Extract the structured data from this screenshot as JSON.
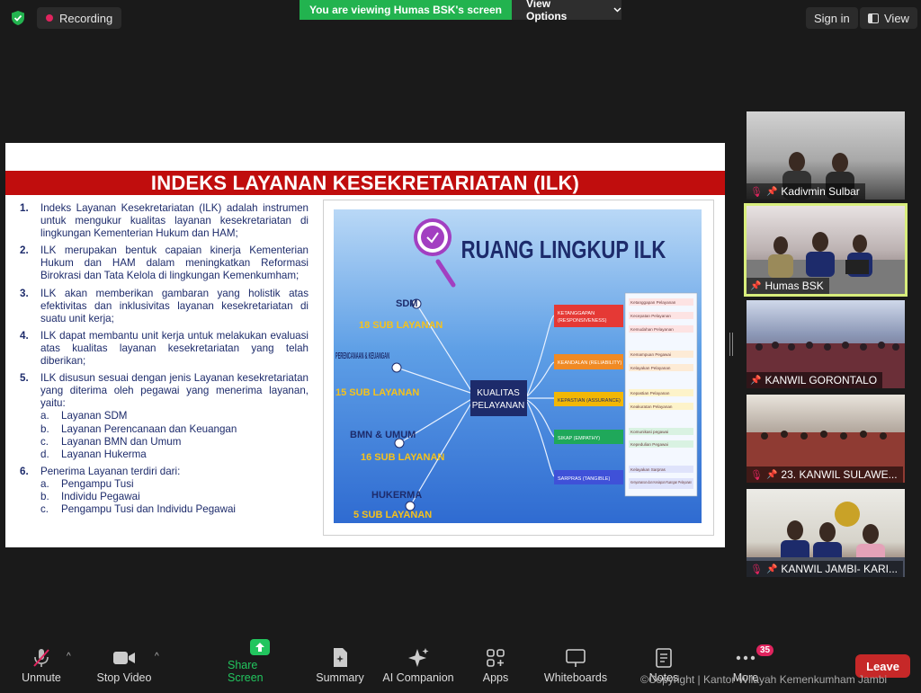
{
  "topbar": {
    "recording_label": "Recording",
    "share_banner": "You are viewing Humas BSK's screen",
    "view_options": "View Options",
    "signin": "Sign in",
    "view": "View"
  },
  "slide": {
    "title": "INDEKS LAYANAN KESEKRETARIATAN (ILK)",
    "points": [
      {
        "num": "1.",
        "text": "Indeks Layanan Kesekretariatan (ILK) adalah instrumen untuk mengukur kualitas layanan kesekretariatan di lingkungan Kementerian Hukum dan HAM;"
      },
      {
        "num": "2.",
        "text": "ILK merupakan bentuk capaian kinerja Kementerian Hukum dan HAM dalam meningkatkan Reformasi Birokrasi dan Tata Kelola di lingkungan Kemenkumham;"
      },
      {
        "num": "3.",
        "text": "ILK akan memberikan gambaran yang holistik atas efektivitas dan inklusivitas layanan kesekretariatan di suatu unit kerja;"
      },
      {
        "num": "4.",
        "text": "ILK dapat membantu unit kerja untuk melakukan evaluasi atas kualitas layanan kesekretariatan yang telah diberikan;"
      },
      {
        "num": "5.",
        "text": "ILK disusun sesuai dengan jenis Layanan kesekretariatan yang diterima oleh pegawai yang menerima layanan, yaitu:"
      },
      {
        "num": "6.",
        "text": "Penerima Layanan terdiri dari:"
      }
    ],
    "sub5": [
      {
        "l": "a.",
        "t": "Layanan SDM"
      },
      {
        "l": "b.",
        "t": "Layanan Perencanaan dan Keuangan"
      },
      {
        "l": "c.",
        "t": "Layanan BMN dan Umum"
      },
      {
        "l": "d.",
        "t": "Layanan Hukerma"
      }
    ],
    "sub6": [
      {
        "l": "a.",
        "t": "Pengampu Tusi"
      },
      {
        "l": "b.",
        "t": "Individu Pegawai"
      },
      {
        "l": "c.",
        "t": "Pengampu Tusi dan Individu Pegawai"
      }
    ]
  },
  "diagram": {
    "title": "RUANG LINGKUP ILK",
    "center": [
      "KUALITAS",
      "PELAYANAN"
    ],
    "sources": [
      {
        "name": "SDM",
        "count": "18 SUB LAYANAN"
      },
      {
        "name": "PERENCANAAN & KEUANGAN",
        "count": "15 SUB LAYANAN"
      },
      {
        "name": "BMN & UMUM",
        "count": "16 SUB LAYANAN"
      },
      {
        "name": "HUKERMA",
        "count": "5 SUB LAYANAN"
      }
    ],
    "dimensions": [
      {
        "label": "KETANGGAPAN (RESPONSIVENESS)",
        "color": "#e53935",
        "items": [
          "Ketanggapan Pelayanan",
          "Kecepatan Pelayanan",
          "Kemudahan Pelayanan"
        ]
      },
      {
        "label": "KEANDALAN (RELIABILITY)",
        "color": "#f08a24",
        "items": [
          "Kemampuan Pegawai",
          "Kelayakan Pelayanan"
        ]
      },
      {
        "label": "KEPASTIAN (ASSURANCE)",
        "color": "#f2b705",
        "items": [
          "Kepastian Pelayanan",
          "Keakuratan Pelayanan"
        ]
      },
      {
        "label": "SIKAP (EMPATHY)",
        "color": "#1fa85a",
        "items": [
          "Komunikasi pegawai",
          "Kepedulian Pegawai"
        ]
      },
      {
        "label": "SARPRAS (TANGIBLE)",
        "color": "#3f51d8",
        "items": [
          "Kelayakan Sarpras",
          "Kenyamanan dan Kesiapan Ruangan Pelayanan"
        ]
      }
    ]
  },
  "participants": [
    {
      "name": "Kadivmin Sulbar"
    },
    {
      "name": "Humas BSK"
    },
    {
      "name": "KANWIL GORONTALO"
    },
    {
      "name": "23. KANWIL SULAWE..."
    },
    {
      "name": "KANWIL JAMBI- KARI..."
    }
  ],
  "toolbar": {
    "unmute": "Unmute",
    "stop_video": "Stop Video",
    "share_screen": "Share Screen",
    "summary": "Summary",
    "ai_companion": "AI Companion",
    "apps": "Apps",
    "whiteboards": "Whiteboards",
    "notes": "Notes",
    "more": "More",
    "more_badge": "35",
    "leave": "Leave"
  },
  "copyright": "©Copyright | Kantor Wilayah Kemenkumham Jambi",
  "colors": {
    "share_green": "#22b34f",
    "leave_red": "#c62828",
    "slide_red": "#c00d0d",
    "active_border": "#d8ed7c"
  }
}
